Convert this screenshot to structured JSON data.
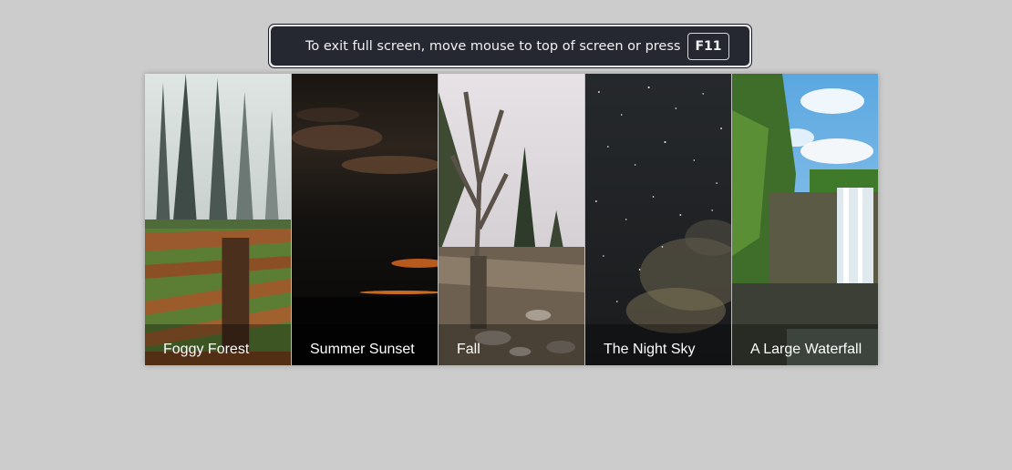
{
  "fullscreen_notice": {
    "message": "To exit full screen, move mouse to top of screen or press",
    "key": "F11"
  },
  "gallery": {
    "panels": [
      {
        "title": "Foggy Forest",
        "image": "foggy-forest-image"
      },
      {
        "title": "Summer Sunset",
        "image": "summer-sunset-image"
      },
      {
        "title": "Fall",
        "image": "fall-image"
      },
      {
        "title": "The Night Sky",
        "image": "night-sky-image"
      },
      {
        "title": "A Large Waterfall",
        "image": "waterfall-image"
      }
    ]
  }
}
